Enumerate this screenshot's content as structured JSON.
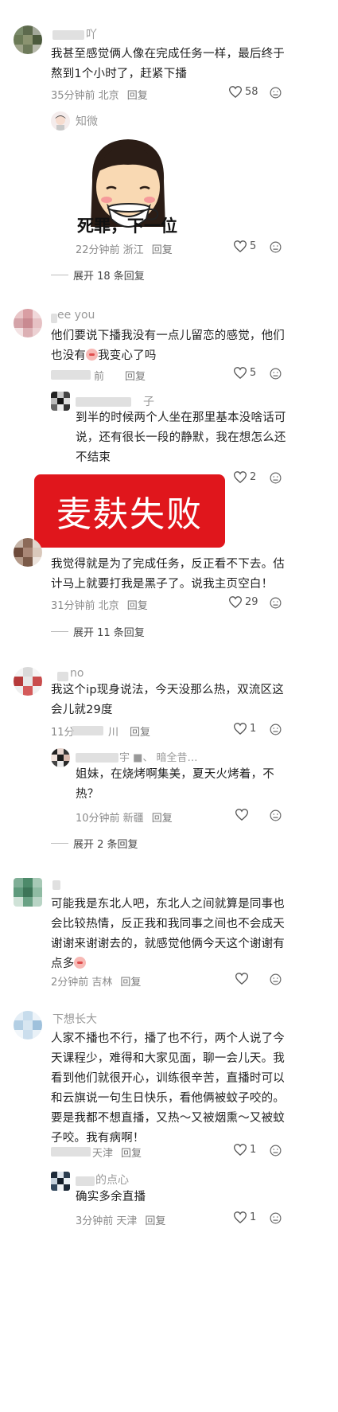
{
  "banner": "麦麸失败",
  "comments": [
    {
      "username": "吖",
      "text": [
        "我甚至感觉俩人像在完成任务一样，最后终于",
        "熬到1个小时了，赶紧下播"
      ],
      "time": "35分钟前 北京",
      "reply": "回复",
      "likes": "58"
    },
    {
      "username": "知微",
      "sticker_caption": "死罪，下一位",
      "time": "22分钟前 浙江",
      "reply": "回复",
      "likes": "5"
    },
    {
      "expand": "展开 18 条回复"
    },
    {
      "username": "ee you",
      "text": [
        "他们要说下播我没有一点儿留恋的感觉，他们",
        "也没有",
        "我变心了吗"
      ],
      "time": "前",
      "reply": "回复",
      "likes": "5"
    },
    {
      "username": "子",
      "text": [
        "到半的时候两个人坐在那里基本没啥话可",
        "说，还有很长一段的静默，我在想怎么还",
        "不结束"
      ],
      "likes": "2"
    },
    {
      "username": "",
      "text": [
        "我觉得就是为了完成任务，反正看不下去。估",
        "计马上就要打我是黑子了。说我主页空白！"
      ],
      "time": "31分钟前 北京",
      "reply": "回复",
      "likes": "29"
    },
    {
      "expand": "展开 11 条回复"
    },
    {
      "username": "no",
      "text": [
        "我这个ip现身说法，今天没那么热，双流区这",
        "会儿就29度"
      ],
      "time": "11分",
      "time_tail": "川",
      "reply": "回复",
      "likes": "1"
    },
    {
      "username": "宇 ■、 暗全昔…",
      "text": [
        "姐妹，在烧烤啊集美，夏天火烤着，不",
        "热？"
      ],
      "time": "10分钟前 新疆",
      "reply": "回复",
      "likes": ""
    },
    {
      "expand": "展开 2 条回复"
    },
    {
      "username": "",
      "text": [
        "可能我是东北人吧，东北人之间就算是同事也",
        "会比较热情，反正我和我同事之间也不会成天",
        "谢谢来谢谢去的，就感觉他俩今天这个谢谢有",
        "点多"
      ],
      "time": "2分钟前 吉林",
      "reply": "回复",
      "likes": ""
    },
    {
      "username": "下想长大",
      "text": [
        "人家不播也不行，播了也不行，两个人说了今",
        "天课程少，难得和大家见面，聊一会儿天。我",
        "看到他们就很开心，训练很辛苦，直播时可以",
        "和云旗说一句生日快乐，看他俩被蚊子咬的。",
        "要是我都不想直播，又热～又被烟熏～又被蚊",
        "子咬。我有病啊！"
      ],
      "time": "天津",
      "reply": "回复",
      "likes": "1"
    },
    {
      "username": "的点心",
      "text": [
        "确实多余直播"
      ],
      "time": "3分钟前 天津",
      "reply": "回复",
      "likes": "1"
    }
  ],
  "icons": [
    "heart-icon",
    "dislike-icon",
    "pixelated-avatar",
    "sticker-girl-drinking"
  ],
  "colors": {
    "banner": "#e0161c",
    "text": "#222222",
    "meta": "#8a8a8a"
  }
}
